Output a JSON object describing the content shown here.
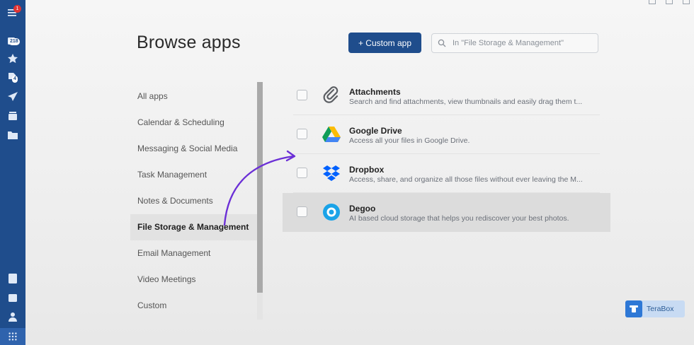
{
  "rail": {
    "menu_badge": "1",
    "inbox_badge": "218",
    "docs_badge": "4"
  },
  "page": {
    "title": "Browse apps",
    "custom_app_label": "+ Custom app",
    "search_placeholder": "In \"File Storage & Management\""
  },
  "categories": [
    "All apps",
    "Calendar & Scheduling",
    "Messaging & Social Media",
    "Task Management",
    "Notes & Documents",
    "File Storage & Management",
    "Email Management",
    "Video Meetings",
    "Custom"
  ],
  "selected_category": "File Storage & Management",
  "apps": [
    {
      "name": "Attachments",
      "desc": "Search and find attachments, view thumbnails and easily drag them t...",
      "icon": "paperclip-icon"
    },
    {
      "name": "Google Drive",
      "desc": "Access all your files in Google Drive.",
      "icon": "google-drive-icon"
    },
    {
      "name": "Dropbox",
      "desc": "Access, share, and organize all those files without ever leaving the M...",
      "icon": "dropbox-icon"
    },
    {
      "name": "Degoo",
      "desc": "AI based cloud storage that helps you rediscover your best photos.",
      "icon": "degoo-icon"
    }
  ],
  "watermark": {
    "label": "TeraBox"
  },
  "colors": {
    "brand": "#1f4d8c",
    "arrow": "#6b2fd6",
    "badge": "#e03434"
  }
}
